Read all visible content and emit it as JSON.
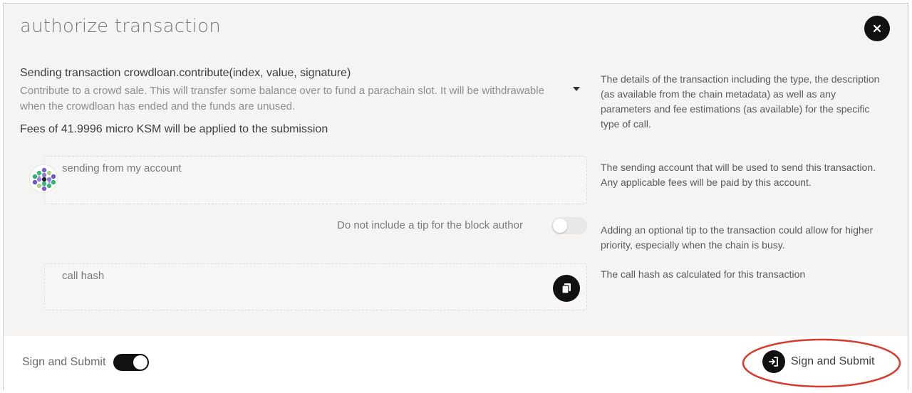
{
  "dialog": {
    "title": "authorize transaction",
    "close_icon": "close-icon"
  },
  "transaction": {
    "heading": "Sending transaction crowdloan.contribute(index, value, signature)",
    "description": "Contribute to a crowd sale. This will transfer some balance over to fund a parachain slot. It will be withdrawable when the crowdloan has ended and the funds are unused.",
    "fees": "Fees of 41.9996 micro KSM will be applied to the submission",
    "expand_icon": "caret-down-icon",
    "help": "The details of the transaction including the type, the description (as available from the chain metadata) as well as any parameters and fee estimations (as available) for the specific type of call."
  },
  "account": {
    "label": "sending from my account",
    "value": "",
    "avatar_icon": "identicon",
    "help": "The sending account that will be used to send this transaction. Any applicable fees will be paid by this account."
  },
  "tip": {
    "label": "Do not include a tip for the block author",
    "enabled": false,
    "help": "Adding an optional tip to the transaction could allow for higher priority, especially when the chain is busy."
  },
  "call_hash": {
    "label": "call hash",
    "value": "",
    "copy_icon": "copy-icon",
    "help": "The call hash as calculated for this transaction"
  },
  "footer": {
    "toggle_label": "Sign and Submit",
    "toggle_enabled": true,
    "submit_label": "Sign and Submit",
    "submit_icon": "sign-in-icon",
    "highlight_color": "#d93a2b"
  }
}
